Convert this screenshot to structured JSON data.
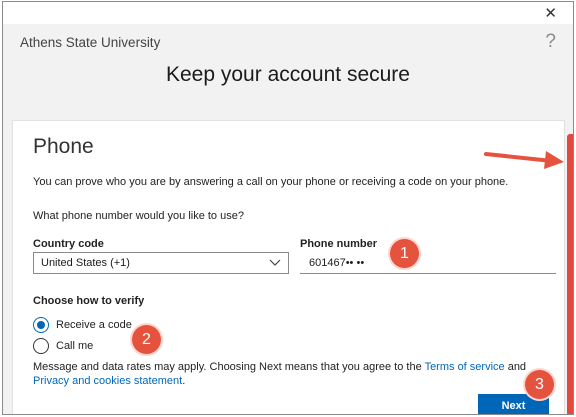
{
  "window": {
    "close_glyph": "✕",
    "help_glyph": "?"
  },
  "header": {
    "org_name": "Athens State University",
    "title": "Keep your account secure"
  },
  "phone_section": {
    "heading": "Phone",
    "intro": "You can prove who you are by answering a call on your phone or receiving a code on your phone.",
    "question": "What phone number would you like to use?",
    "country_label": "Country code",
    "country_value": "United States (+1)",
    "phone_label": "Phone number",
    "phone_value": "601467•• ••"
  },
  "verify": {
    "heading": "Choose how to verify",
    "options": [
      {
        "label": "Receive a code",
        "selected": true
      },
      {
        "label": "Call me",
        "selected": false
      }
    ]
  },
  "disclaimer": {
    "text_before": "Message and data rates may apply. Choosing Next means that you agree to the ",
    "terms_link": "Terms of service",
    "text_and": " and ",
    "privacy_link": "Privacy and cookies statement",
    "text_after": "."
  },
  "next_button": "Next",
  "annotations": {
    "badge_1": "1",
    "badge_2": "2",
    "badge_3": "3",
    "color": "#e5533f"
  },
  "icons": [
    "close-icon",
    "help-icon",
    "chevron-down-icon",
    "arrow-icon"
  ],
  "colors": {
    "accent": "#0067b8",
    "annotation": "#e5533f",
    "header_bg": "#f2f2f2"
  }
}
